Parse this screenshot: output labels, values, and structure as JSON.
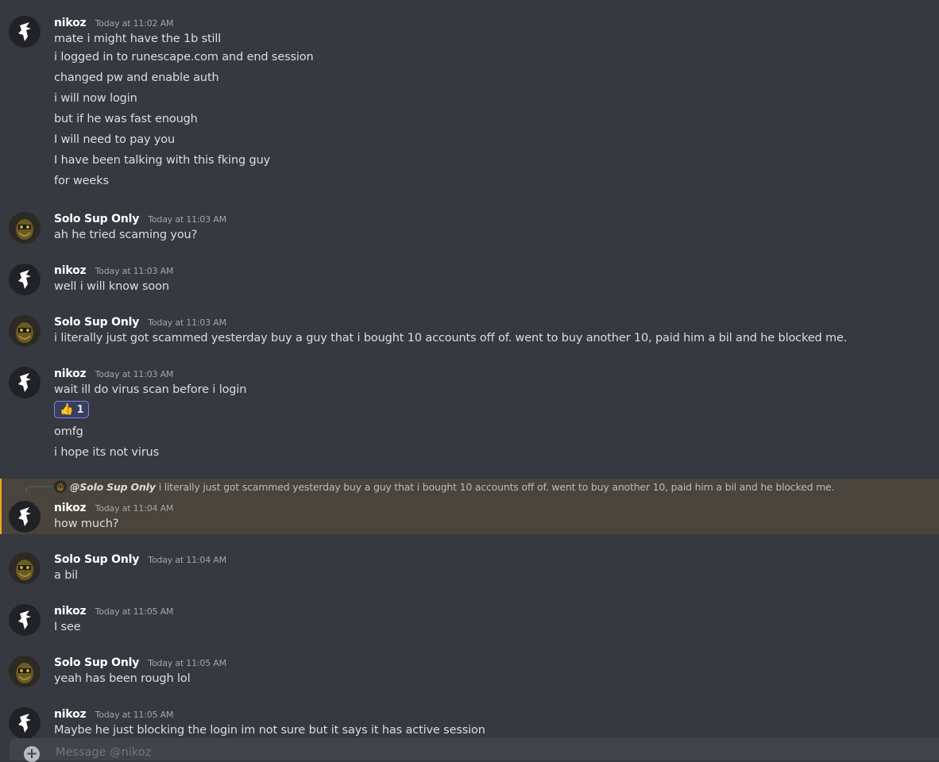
{
  "messages": [
    {
      "author": "nikoz",
      "avatar": "nikoz-avatar",
      "time": "Today at 11:02 AM",
      "lines": [
        "mate i might have the 1b still",
        "i logged in to runescape.com and end session",
        "changed pw and enable auth",
        "i will now login",
        "but if he was fast enough",
        "I will need to pay you",
        "I have been talking with this fking guy",
        "for weeks"
      ]
    },
    {
      "author": "Solo Sup Only",
      "avatar": "solo-avatar",
      "time": "Today at 11:03 AM",
      "lines": [
        "ah he tried scaming you?"
      ]
    },
    {
      "author": "nikoz",
      "avatar": "nikoz-avatar",
      "time": "Today at 11:03 AM",
      "lines": [
        "well i will know soon"
      ]
    },
    {
      "author": "Solo Sup Only",
      "avatar": "solo-avatar",
      "time": "Today at 11:03 AM",
      "lines": [
        "i literally just got scammed yesterday buy a guy that i bought 10 accounts off of. went to buy another 10, paid him a bil and he blocked me."
      ]
    },
    {
      "author": "nikoz",
      "avatar": "nikoz-avatar",
      "time": "Today at 11:03 AM",
      "lines": [
        "wait ill do virus scan before i login"
      ],
      "reaction": {
        "emoji": "👍",
        "count": "1"
      },
      "after_lines": [
        "omfg",
        "i hope its not virus"
      ]
    },
    {
      "author": "nikoz",
      "avatar": "nikoz-avatar",
      "time": "Today at 11:04 AM",
      "lines": [
        "how much?"
      ],
      "reply": {
        "mention": "@Solo Sup Only",
        "text": "i literally just got scammed yesterday buy a guy that i bought 10 accounts off of. went to buy another 10, paid him a bil and he blocked me."
      }
    },
    {
      "author": "Solo Sup Only",
      "avatar": "solo-avatar",
      "time": "Today at 11:04 AM",
      "lines": [
        "a bil"
      ]
    },
    {
      "author": "nikoz",
      "avatar": "nikoz-avatar",
      "time": "Today at 11:05 AM",
      "lines": [
        "I see"
      ]
    },
    {
      "author": "Solo Sup Only",
      "avatar": "solo-avatar",
      "time": "Today at 11:05 AM",
      "lines": [
        "yeah has been rough lol"
      ]
    },
    {
      "author": "nikoz",
      "avatar": "nikoz-avatar",
      "time": "Today at 11:05 AM",
      "lines": [
        "Maybe he just blocking the login im not sure but it says it has active session"
      ]
    }
  ],
  "composer": {
    "placeholder": "Message @nikoz",
    "plus_icon": "add-attachment-icon"
  },
  "colors": {
    "background": "#36393f",
    "reply_highlight": "#49443c",
    "reaction_border": "#7983f5"
  }
}
